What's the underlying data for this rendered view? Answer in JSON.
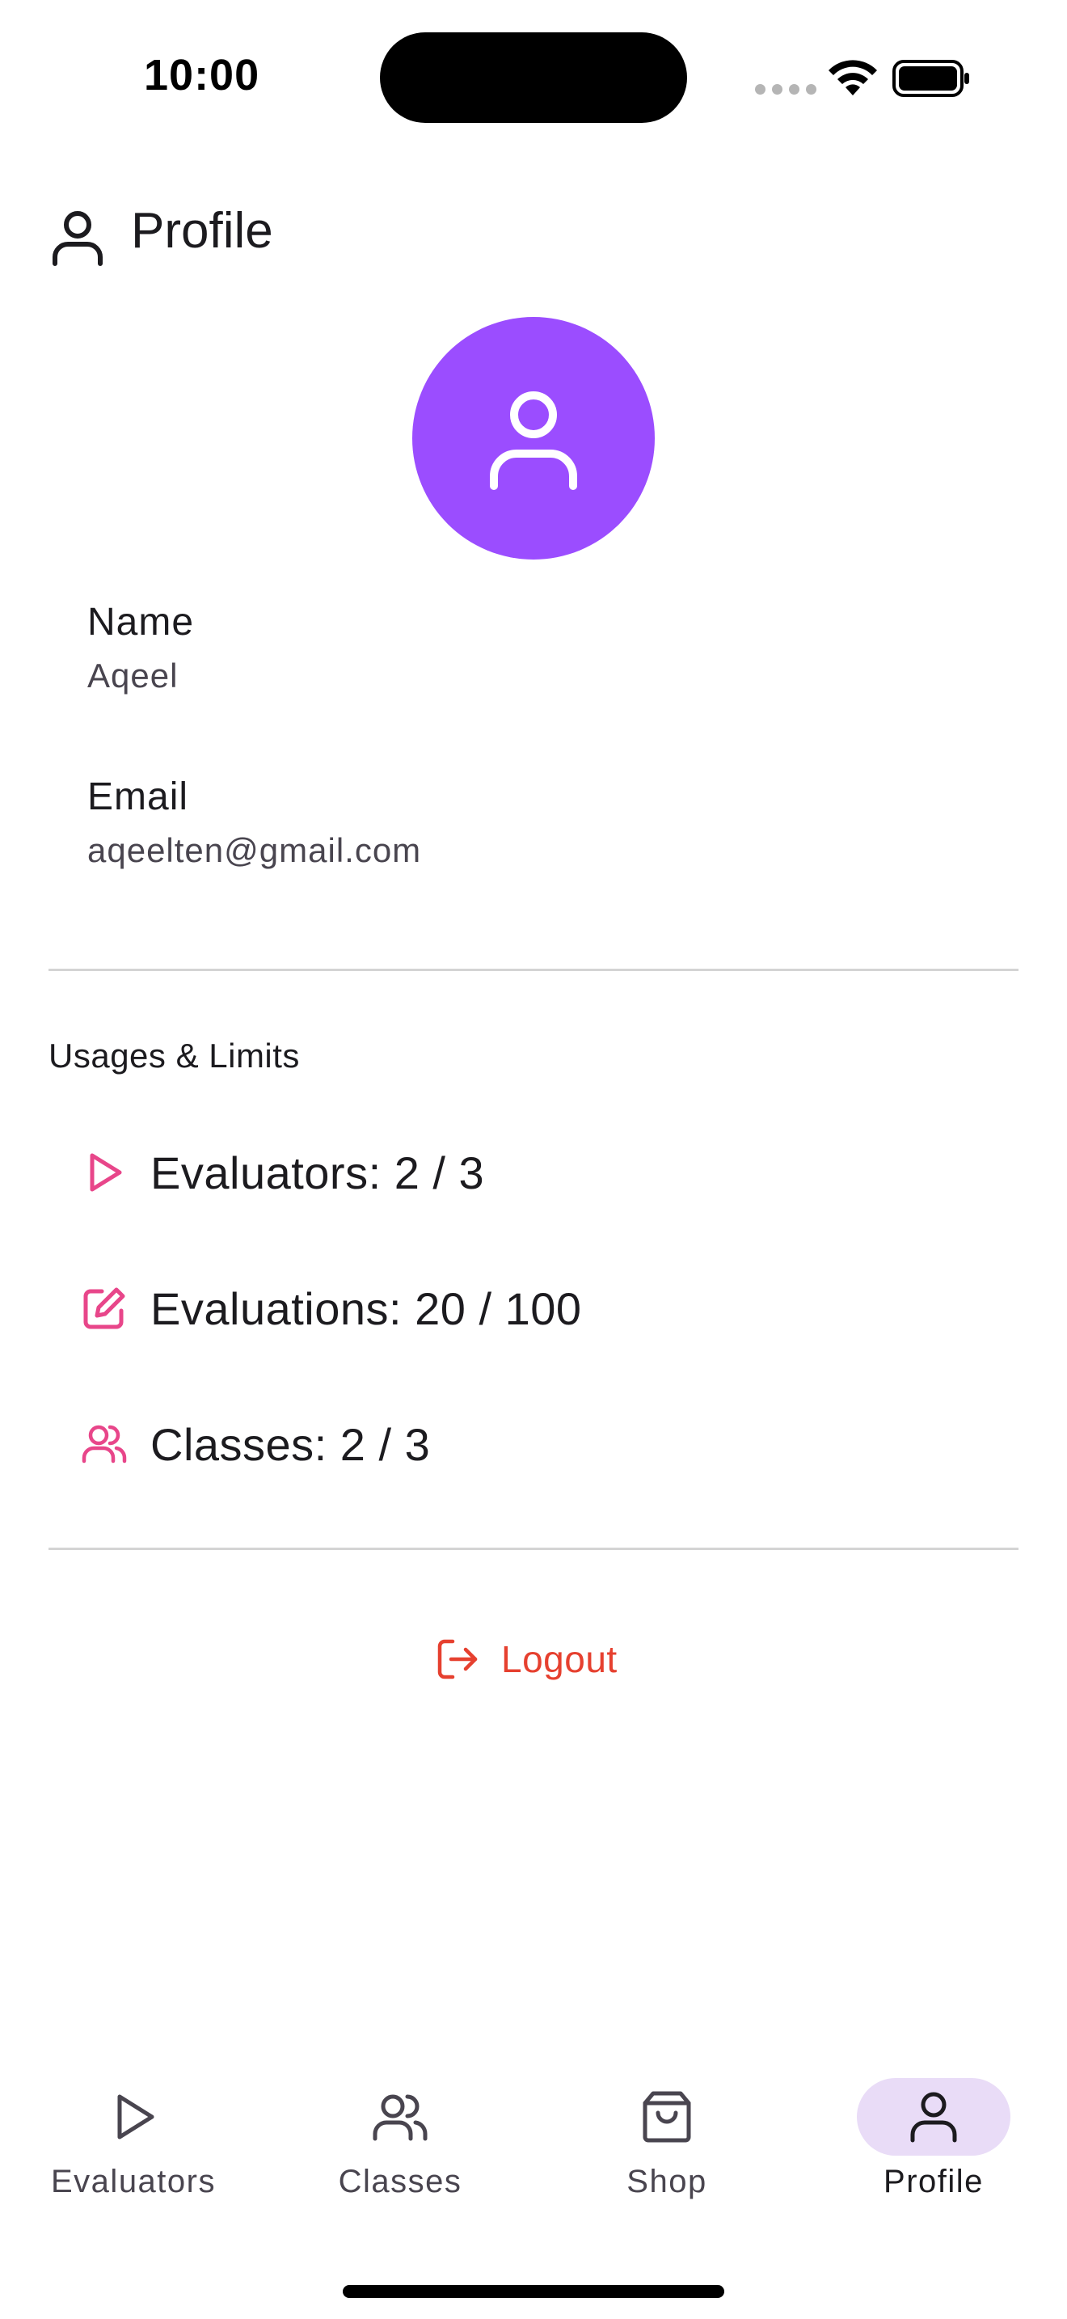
{
  "status_bar": {
    "time": "10:00"
  },
  "header": {
    "title": "Profile",
    "icon": "person-icon"
  },
  "avatar": {
    "icon": "person-icon",
    "color": "#9b4dff"
  },
  "fields": [
    {
      "label": "Name",
      "value": "Aqeel"
    },
    {
      "label": "Email",
      "value": "aqeelten@gmail.com"
    }
  ],
  "usage": {
    "title": "Usages & Limits",
    "items": [
      {
        "text": "Evaluators: 2 / 3",
        "icon": "play-icon"
      },
      {
        "text": "Evaluations: 20 / 100",
        "icon": "edit-icon"
      },
      {
        "text": "Classes: 2 / 3",
        "icon": "users-icon"
      }
    ],
    "accent_color": "#e8468a"
  },
  "logout": {
    "label": "Logout",
    "icon": "logout-icon",
    "color": "#e6402f"
  },
  "nav": {
    "items": [
      {
        "label": "Evaluators",
        "icon": "play-icon",
        "active": false
      },
      {
        "label": "Classes",
        "icon": "users-icon",
        "active": false
      },
      {
        "label": "Shop",
        "icon": "shopping-bag-icon",
        "active": false
      },
      {
        "label": "Profile",
        "icon": "person-icon",
        "active": true
      }
    ],
    "active_color": "#e9dcf7"
  }
}
